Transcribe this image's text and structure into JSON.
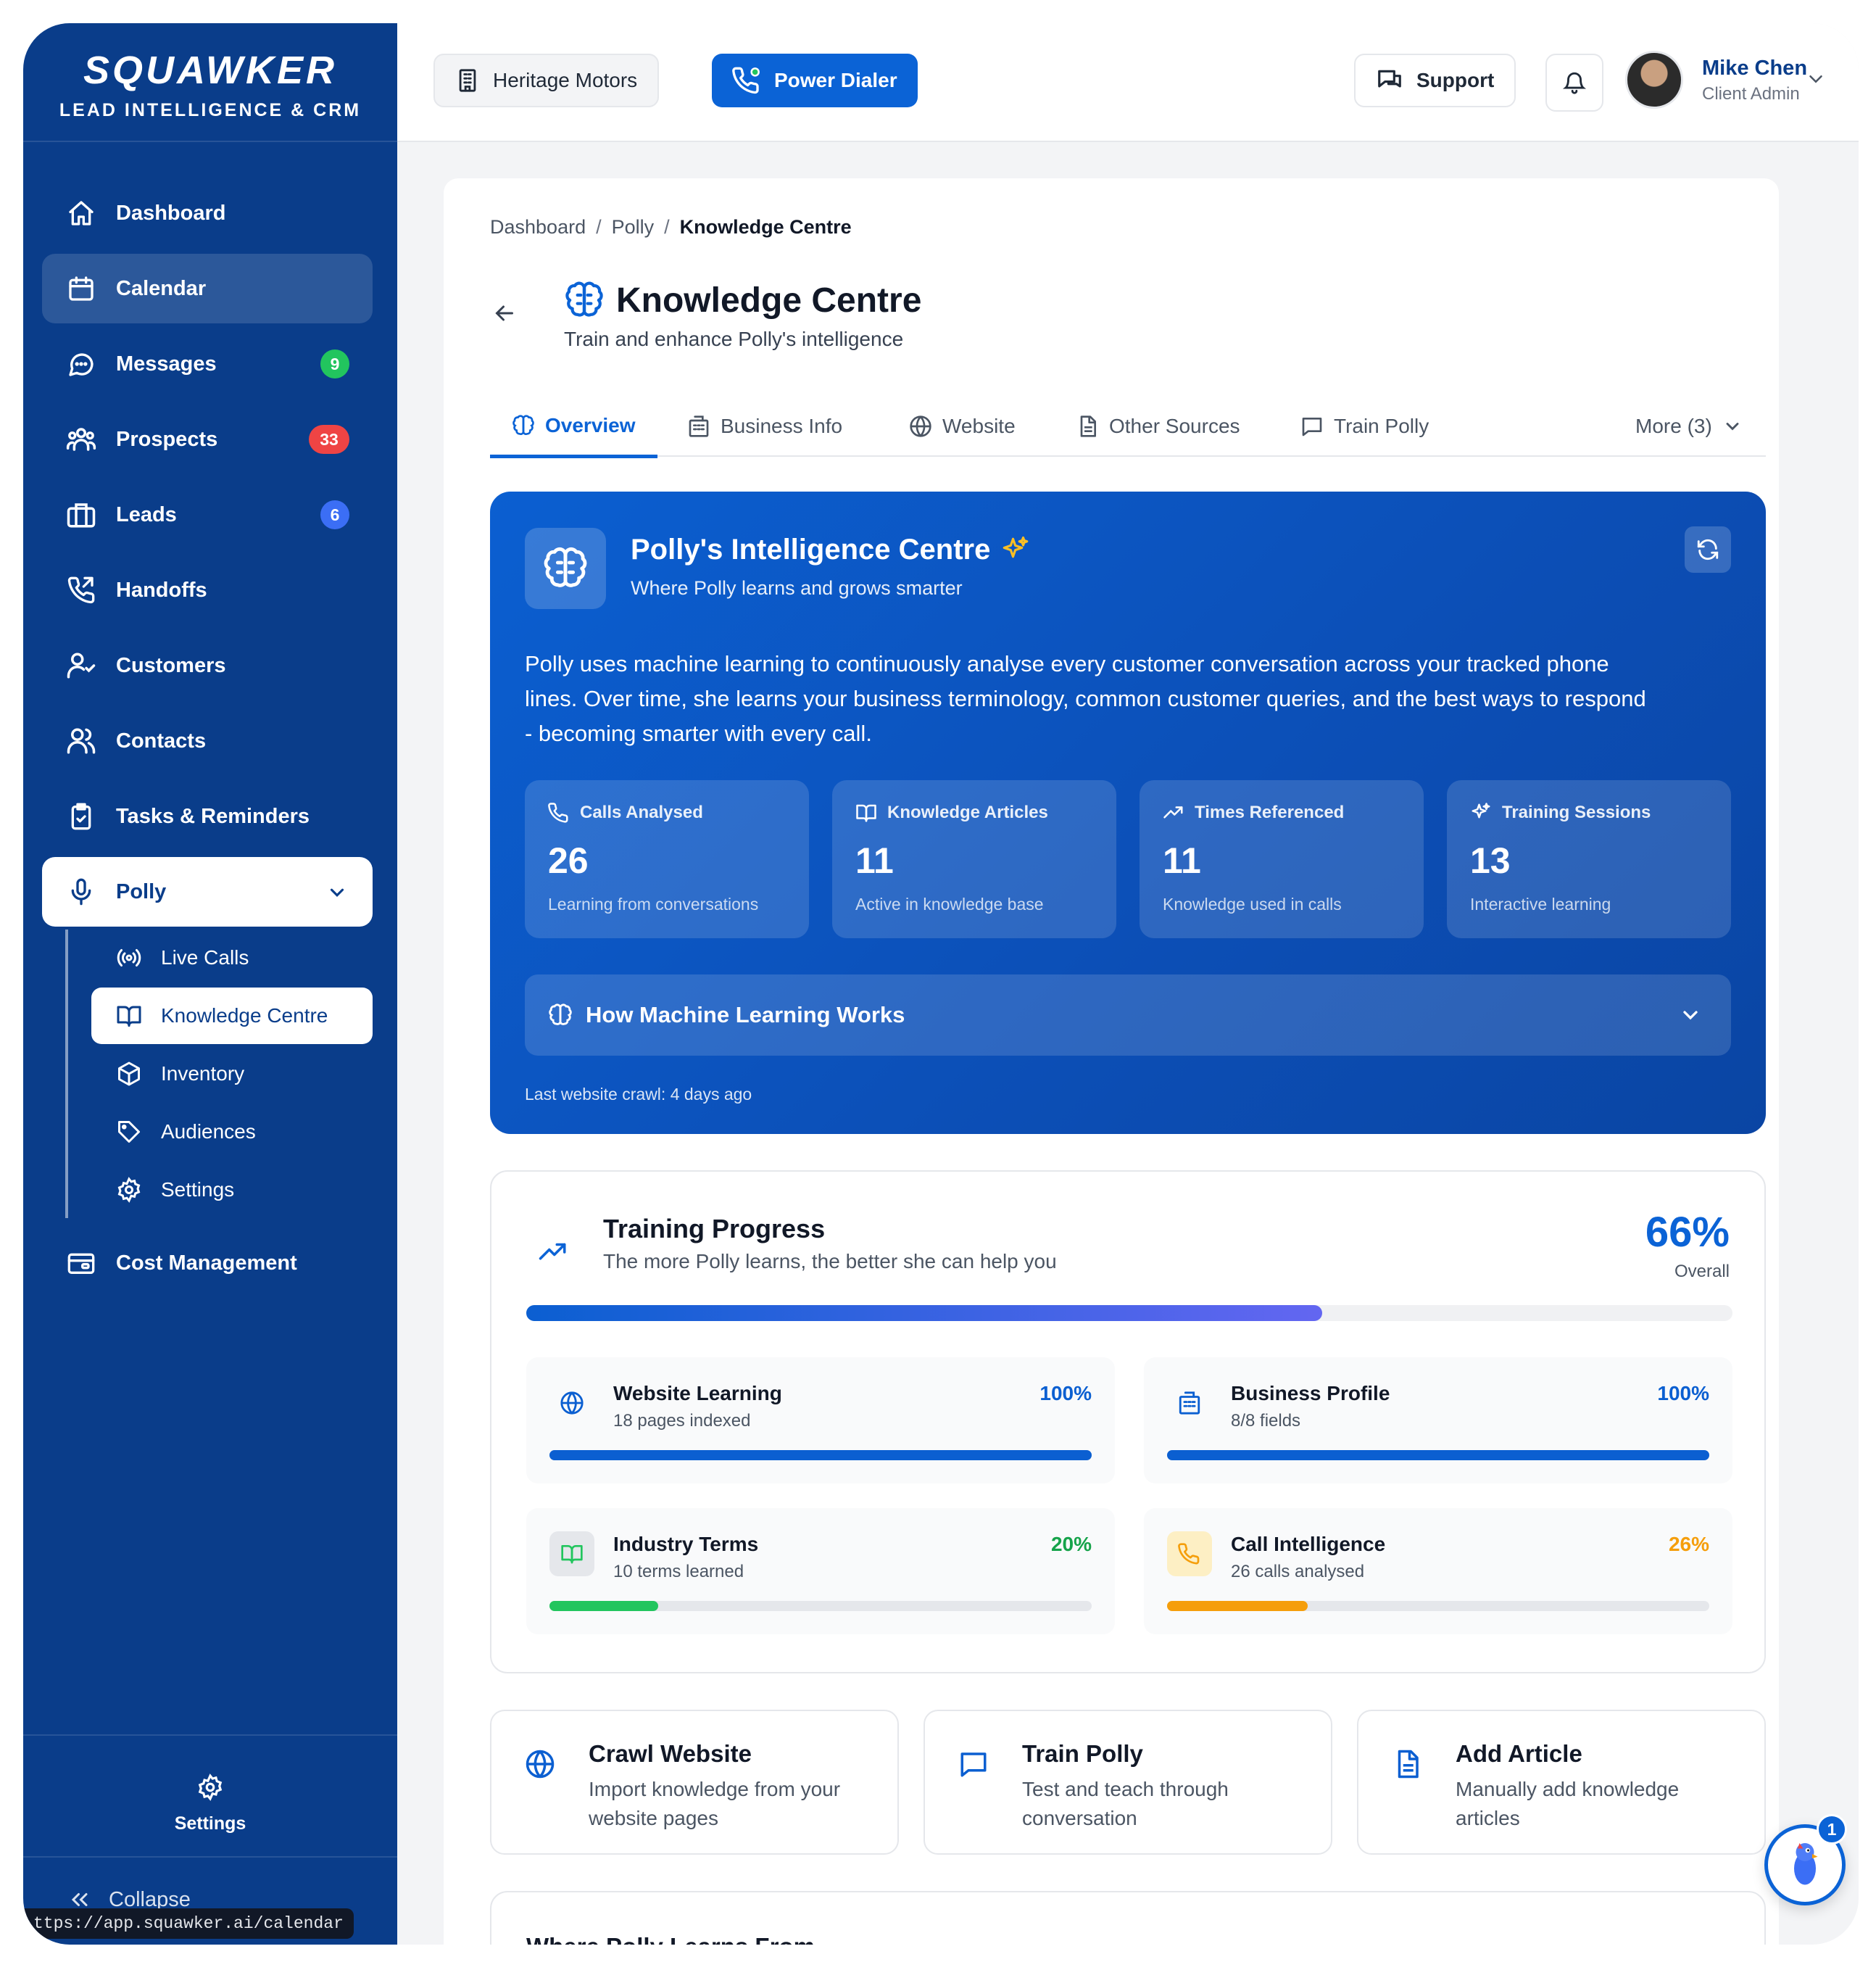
{
  "brand": {
    "name": "SQUAWKER",
    "tagline": "LEAD INTELLIGENCE & CRM"
  },
  "sidebar": {
    "items": [
      {
        "label": "Dashboard",
        "icon": "home-icon"
      },
      {
        "label": "Calendar",
        "icon": "calendar-icon"
      },
      {
        "label": "Messages",
        "icon": "message-icon",
        "badge": "9"
      },
      {
        "label": "Prospects",
        "icon": "users-group-icon",
        "badge": "33"
      },
      {
        "label": "Leads",
        "icon": "briefcase-icon",
        "badge": "6"
      },
      {
        "label": "Handoffs",
        "icon": "phone-forward-icon"
      },
      {
        "label": "Customers",
        "icon": "user-check-icon"
      },
      {
        "label": "Contacts",
        "icon": "users-icon"
      },
      {
        "label": "Tasks & Reminders",
        "icon": "clipboard-check-icon"
      },
      {
        "label": "Polly",
        "icon": "microphone-icon"
      },
      {
        "label": "Cost Management",
        "icon": "wallet-icon"
      }
    ],
    "polly_sub": [
      {
        "label": "Live Calls",
        "icon": "broadcast-icon"
      },
      {
        "label": "Knowledge Centre",
        "icon": "book-open-icon"
      },
      {
        "label": "Inventory",
        "icon": "box-icon"
      },
      {
        "label": "Audiences",
        "icon": "tag-icon"
      },
      {
        "label": "Settings",
        "icon": "gear-icon"
      }
    ],
    "settings_label": "Settings",
    "collapse_label": "Collapse",
    "status_url": "ttps://app.squawker.ai/calendar"
  },
  "topbar": {
    "org": "Heritage Motors",
    "dialer": "Power Dialer",
    "support": "Support",
    "user_name": "Mike Chen",
    "user_role": "Client Admin"
  },
  "breadcrumb": {
    "items": [
      "Dashboard",
      "Polly"
    ],
    "current": "Knowledge Centre"
  },
  "page": {
    "title": "Knowledge Centre",
    "subtitle": "Train and enhance Polly's intelligence"
  },
  "tabs": [
    {
      "label": "Overview",
      "icon": "brain-icon"
    },
    {
      "label": "Business Info",
      "icon": "building-icon"
    },
    {
      "label": "Website",
      "icon": "globe-icon"
    },
    {
      "label": "Other Sources",
      "icon": "document-icon"
    },
    {
      "label": "Train Polly",
      "icon": "chat-icon"
    },
    {
      "label": "More (3)",
      "icon": "chevron-down-icon"
    }
  ],
  "hero": {
    "title": "Polly's Intelligence Centre",
    "subtitle": "Where Polly learns and grows smarter",
    "description": "Polly uses machine learning to continuously analyse every customer conversation across your tracked phone lines. Over time, she learns your business terminology, common customer queries, and the best ways to respond - becoming smarter with every call.",
    "stats": [
      {
        "label": "Calls Analysed",
        "value": "26",
        "note": "Learning from conversations"
      },
      {
        "label": "Knowledge Articles",
        "value": "11",
        "note": "Active in knowledge base"
      },
      {
        "label": "Times Referenced",
        "value": "11",
        "note": "Knowledge used in calls"
      },
      {
        "label": "Training Sessions",
        "value": "13",
        "note": "Interactive learning"
      }
    ],
    "ml_title": "How Machine Learning Works",
    "last_crawl": "Last website crawl: 4 days ago"
  },
  "training": {
    "title": "Training Progress",
    "subtitle": "The more Polly learns, the better she can help you",
    "overall_pct": "66%",
    "overall_label": "Overall",
    "overall_value": 0.66,
    "items": [
      {
        "name": "Website Learning",
        "sub": "18 pages indexed",
        "pct": "100%",
        "value": 1.0,
        "color": "#0b5fd1"
      },
      {
        "name": "Business Profile",
        "sub": "8/8 fields",
        "pct": "100%",
        "value": 1.0,
        "color": "#0b5fd1"
      },
      {
        "name": "Industry Terms",
        "sub": "10 terms learned",
        "pct": "20%",
        "value": 0.2,
        "color": "#22c55e"
      },
      {
        "name": "Call Intelligence",
        "sub": "26 calls analysed",
        "pct": "26%",
        "value": 0.26,
        "color": "#f59e0b"
      }
    ]
  },
  "actions": [
    {
      "title": "Crawl Website",
      "desc": "Import knowledge from your website pages"
    },
    {
      "title": "Train Polly",
      "desc": "Test and teach through conversation"
    },
    {
      "title": "Add Article",
      "desc": "Manually add knowledge articles"
    }
  ],
  "learn_section": {
    "title": "Where Polly Learns From"
  },
  "fab": {
    "badge": "1"
  }
}
